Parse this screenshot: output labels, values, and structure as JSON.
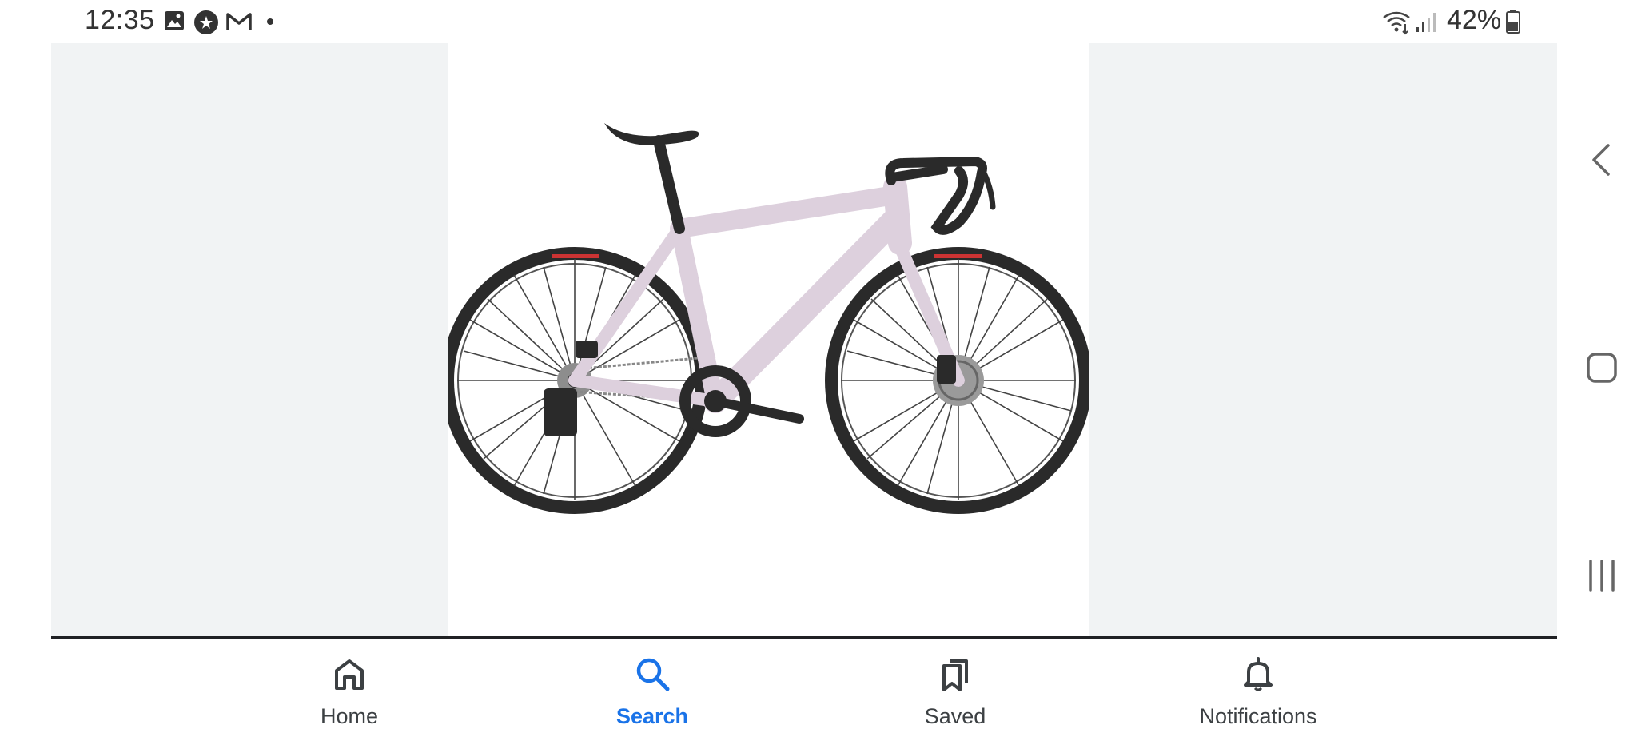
{
  "status_bar": {
    "time": "12:35",
    "battery_percent": "42%",
    "left_icons": [
      "gallery-icon",
      "star-badge-icon",
      "gmail-icon",
      "dot-icon"
    ],
    "right_icons": [
      "wifi-icon",
      "signal-icon",
      "battery-icon"
    ]
  },
  "viewer": {
    "image_subject": "bicycle",
    "frame_color": "#f1f3f4",
    "bike_frame_color": "#ddd0dd"
  },
  "bottom_nav": {
    "items": [
      {
        "label": "Home",
        "icon": "home-icon",
        "active": false
      },
      {
        "label": "Search",
        "icon": "search-icon",
        "active": true
      },
      {
        "label": "Saved",
        "icon": "bookmarks-icon",
        "active": false
      },
      {
        "label": "Notifications",
        "icon": "bell-icon",
        "active": false
      }
    ],
    "active_color": "#1a73e8",
    "inactive_color": "#3c4043"
  },
  "system_nav": {
    "buttons": [
      "back-icon",
      "home-square-icon",
      "recents-icon"
    ]
  }
}
